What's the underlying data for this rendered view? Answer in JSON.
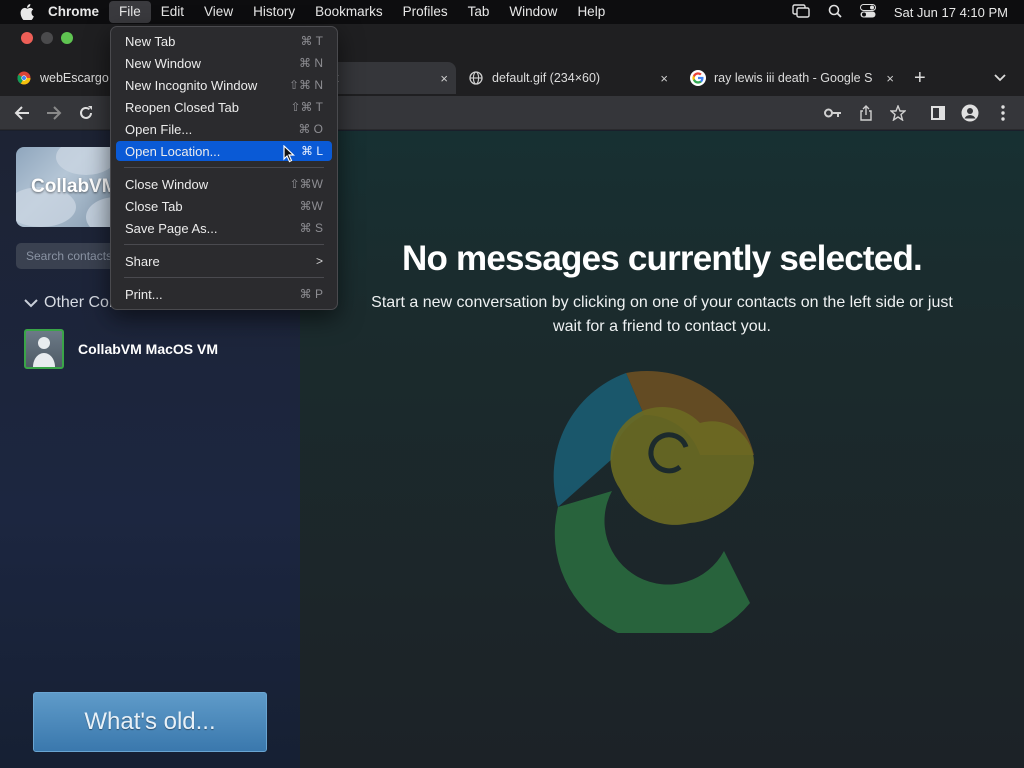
{
  "menubar": {
    "app": "Chrome",
    "items": [
      "File",
      "Edit",
      "View",
      "History",
      "Bookmarks",
      "Profiles",
      "Tab",
      "Window",
      "Help"
    ],
    "clock": "Sat Jun 17  4:10 PM"
  },
  "tabs": [
    {
      "title": "webEscargo",
      "close": "×"
    },
    {
      "title": "t",
      "close": "×"
    },
    {
      "title": "default.gif (234×60)",
      "close": "×"
    },
    {
      "title": "ray lewis iii death - Google S",
      "close": "×"
    }
  ],
  "new_tab": "+",
  "file_menu": {
    "items": [
      {
        "label": "New Tab",
        "shortcut": "⌘ T"
      },
      {
        "label": "New Window",
        "shortcut": "⌘ N"
      },
      {
        "label": "New Incognito Window",
        "shortcut": "⇧⌘ N"
      },
      {
        "label": "Reopen Closed Tab",
        "shortcut": "⇧⌘ T"
      },
      {
        "label": "Open File...",
        "shortcut": "⌘ O"
      },
      {
        "label": "Open Location...",
        "shortcut": "⌘ L"
      },
      {
        "label": "Close Window",
        "shortcut": "⇧⌘W"
      },
      {
        "label": "Close Tab",
        "shortcut": "⌘W"
      },
      {
        "label": "Save Page As...",
        "shortcut": "⌘ S"
      },
      {
        "label": "Share",
        "shortcut": ">"
      },
      {
        "label": "Print...",
        "shortcut": "⌘ P"
      }
    ]
  },
  "sidebar": {
    "profile_name": "CollabVM",
    "search_placeholder": "Search contacts",
    "group_label": "Other Contacts",
    "contacts": [
      {
        "name": "CollabVM MacOS VM"
      }
    ],
    "bottom_button": "What's old..."
  },
  "main": {
    "headline": "No messages currently selected.",
    "subline": "Start a new conversation by clicking on one of your contacts on the left side or just wait for a friend to contact you."
  },
  "colors": {
    "accent": "#0a5ad6",
    "logo_blue": "#1b5c72",
    "logo_orange": "#6b4f22",
    "logo_olive": "#6b6a22",
    "logo_green": "#2a6a3e"
  }
}
